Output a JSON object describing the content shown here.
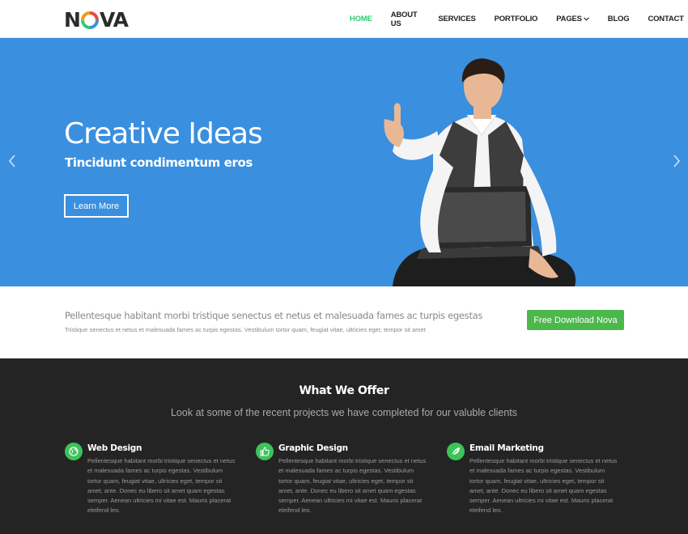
{
  "logo": {
    "text_left": "N",
    "text_right": "VA"
  },
  "nav": {
    "items": [
      {
        "label": "HOME",
        "active": true
      },
      {
        "label": "ABOUT US"
      },
      {
        "label": "SERVICES"
      },
      {
        "label": "PORTFOLIO"
      },
      {
        "label": "PAGES"
      },
      {
        "label": "BLOG"
      },
      {
        "label": "CONTACT"
      }
    ],
    "pages_caret": "⌄"
  },
  "hero": {
    "title": "Creative Ideas",
    "subtitle": "Tincidunt condimentum eros",
    "button": "Learn More",
    "background": "#3a8fdf"
  },
  "cta": {
    "title": "Pellentesque habitant morbi tristique senectus et netus et malesuada fames ac turpis egestas",
    "text": "Tristique senectus et netus et malesuada fames ac turpis egestas. Vestibulum tortor quam, feugiat vitae, ultricies eget, tempor sit amet",
    "button": "Free Download Nova",
    "button_color": "#4cb84c"
  },
  "services": {
    "heading": "What We Offer",
    "subheading": "Look at some of the recent projects we have completed for our valuble clients",
    "items": [
      {
        "title": "Web Design",
        "icon": "globe-icon",
        "text": "Pellentesque habitant morbi tristique senectus et netus et malesuada fames ac turpis egestas. Vestibulum tortor quam, feugiat vitae, ultricies eget, tempor sit amet, ante. Donec eu libero sit amet quam egestas semper. Aenean ultricies mi vitae est. Mauris placerat eleifend leo."
      },
      {
        "title": "Graphic Design",
        "icon": "thumbs-up-icon",
        "text": "Pellentesque habitant morbi tristique senectus et netus et malesuada fames ac turpis egestas. Vestibulum tortor quam, feugiat vitae, ultricies eget, tempor sit amet, ante. Donec eu libero sit amet quam egestas semper. Aenean ultricies mi vitae est. Mauris placerat eleifend leo."
      },
      {
        "title": "Email Marketing",
        "icon": "leaf-icon",
        "text": "Pellentesque habitant morbi tristique senectus et netus et malesuada fames ac turpis egestas. Vestibulum tortor quam, feugiat vitae, ultricies eget, tempor sit amet, ante. Donec eu libero sit amet quam egestas semper. Aenean ultricies mi vitae est. Mauris placerat eleifend leo."
      }
    ],
    "accent": "#3cc35a"
  }
}
